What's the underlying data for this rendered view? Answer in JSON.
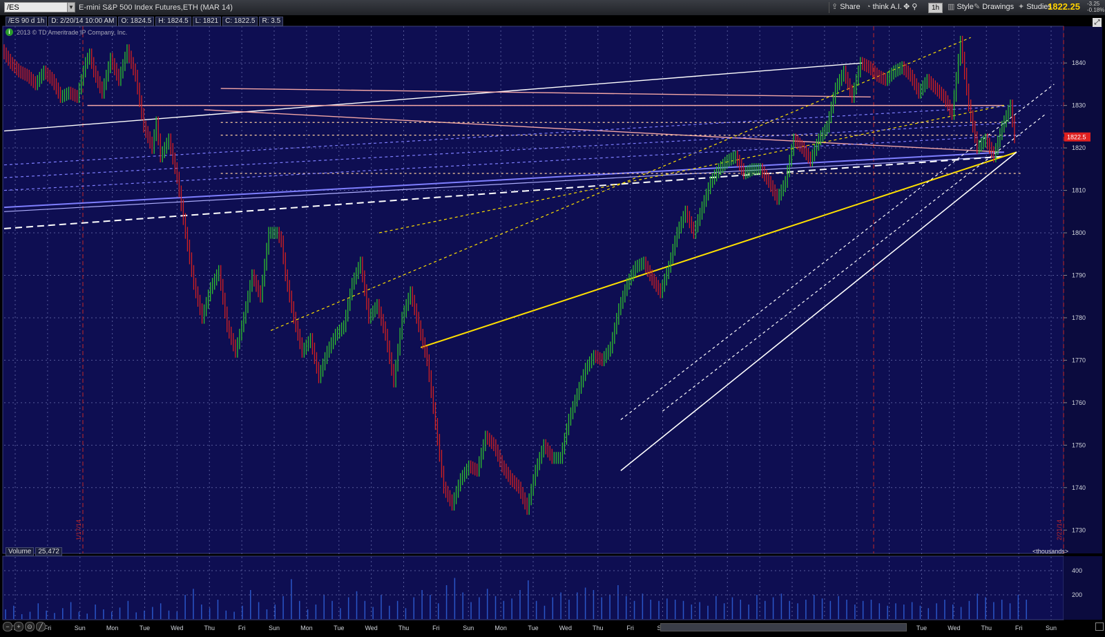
{
  "toolbar": {
    "symbol": "/ES",
    "instrument": "E-mini S&P 500 Index Futures,ETH (MAR 14)",
    "buttons": [
      "Share",
      "think A.I.",
      "1h",
      "Style",
      "Drawings",
      "Studies"
    ],
    "last_price": "1822.25",
    "change_abs": "-3.25",
    "change_pct": "-0.18%"
  },
  "info": {
    "period": "/ES 90 d 1h",
    "date": "D: 2/20/14 10:00 AM",
    "open": "O: 1824.5",
    "high": "H: 1824.5",
    "low": "L: 1821",
    "close": "C: 1822.5",
    "range": "R: 3.5",
    "copyright": "2013 © TD Ameritrade IP Company, Inc."
  },
  "volume_panel": {
    "label": "Volume",
    "value": "25,472",
    "unit": "<thousands>",
    "ticks": [
      "400",
      "200"
    ]
  },
  "colors": {
    "background": "#0e0e52",
    "up": "#2fbf2f",
    "down": "#d42020",
    "price_tag": "#e02020",
    "volume": "#2a56c8"
  },
  "chart_data": {
    "type": "line",
    "title": "",
    "price_axis": {
      "ylim": [
        1725,
        1848
      ],
      "ticks": [
        1730,
        1740,
        1750,
        1760,
        1770,
        1780,
        1790,
        1800,
        1810,
        1820,
        1830,
        1840
      ],
      "current_price": "1822.5"
    },
    "x_tick_labels": [
      "Thu",
      "Fri",
      "Sun",
      "Mon",
      "Tue",
      "Wed",
      "Thu",
      "Fri",
      "Sun",
      "Mon",
      "Tue",
      "Wed",
      "Thu",
      "Fri",
      "Sun",
      "Mon",
      "Tue",
      "Wed",
      "Thu",
      "Fri",
      "Sun",
      "Mon",
      "Tue",
      "Wed",
      "Thu",
      "Fri",
      "Sun",
      "Mon",
      "Tue",
      "Wed",
      "Thu",
      "Fri",
      "Sun"
    ],
    "date_markers": [
      "1/17/14",
      "2/21/14"
    ],
    "grid": true,
    "series": [
      {
        "name": "/ES",
        "x": [
          0,
          2,
          4,
          6,
          8,
          10,
          12,
          14,
          16,
          18,
          20,
          21,
          22,
          24,
          26,
          28,
          30,
          32,
          34,
          36,
          37,
          38,
          40,
          42,
          44,
          46,
          48,
          50,
          52,
          54,
          56,
          58,
          60,
          62,
          64,
          66,
          67,
          68,
          70,
          72,
          74,
          76,
          78,
          80,
          82,
          84,
          86,
          88,
          90,
          92,
          94,
          96,
          98,
          100,
          102,
          104,
          106,
          108,
          110,
          112,
          114,
          116,
          118,
          120,
          122,
          124,
          126,
          128,
          130,
          132,
          134,
          136,
          138,
          140,
          142,
          144,
          146,
          148,
          150,
          152,
          154,
          156,
          158,
          160,
          162,
          164,
          166,
          168,
          170,
          172,
          174,
          176,
          178,
          180,
          182,
          184,
          186,
          188,
          190,
          192,
          194,
          196,
          198,
          200,
          202,
          204,
          206,
          208,
          210,
          212,
          214,
          216,
          218,
          220,
          222,
          224,
          226,
          228,
          230,
          232,
          234,
          236,
          238,
          240,
          242,
          243
        ],
        "y": [
          1843,
          1840,
          1838,
          1837,
          1835,
          1838,
          1836,
          1832,
          1833,
          1832,
          1840,
          1842,
          1838,
          1833,
          1841,
          1836,
          1843,
          1837,
          1825,
          1820,
          1826,
          1818,
          1822,
          1813,
          1800,
          1788,
          1780,
          1787,
          1791,
          1778,
          1772,
          1780,
          1790,
          1785,
          1800,
          1800,
          1798,
          1790,
          1780,
          1772,
          1775,
          1766,
          1772,
          1776,
          1778,
          1788,
          1793,
          1780,
          1783,
          1776,
          1765,
          1780,
          1786,
          1778,
          1770,
          1755,
          1740,
          1736,
          1742,
          1745,
          1744,
          1752,
          1750,
          1745,
          1742,
          1740,
          1735,
          1744,
          1750,
          1747,
          1747,
          1756,
          1762,
          1768,
          1771,
          1770,
          1773,
          1782,
          1788,
          1792,
          1793,
          1789,
          1786,
          1792,
          1800,
          1805,
          1800,
          1806,
          1812,
          1815,
          1817,
          1818,
          1814,
          1815,
          1815,
          1812,
          1808,
          1812,
          1822,
          1820,
          1817,
          1822,
          1825,
          1834,
          1838,
          1832,
          1840,
          1839,
          1837,
          1836,
          1838,
          1839,
          1837,
          1833,
          1836,
          1834,
          1832,
          1828,
          1845,
          1830,
          1820,
          1822,
          1818,
          1825,
          1830,
          1822.5
        ]
      }
    ],
    "volume": {
      "ylim": [
        0,
        480
      ],
      "values": [
        80,
        110,
        40,
        60,
        130,
        70,
        50,
        90,
        140,
        60,
        45,
        120,
        80,
        60,
        95,
        150,
        55,
        70,
        100,
        130,
        70,
        60,
        200,
        250,
        120,
        90,
        160,
        70,
        60,
        110,
        240,
        140,
        80,
        120,
        190,
        330,
        150,
        80,
        120,
        200,
        150,
        90,
        180,
        230,
        150,
        100,
        200,
        110,
        150,
        90,
        180,
        240,
        200,
        130,
        280,
        340,
        220,
        140,
        180,
        250,
        190,
        150,
        170,
        240,
        320,
        150,
        110,
        180,
        220,
        160,
        220,
        260,
        240,
        180,
        200,
        280,
        190,
        150,
        210,
        160,
        150,
        170,
        160,
        150,
        120,
        140,
        110,
        190,
        130,
        180,
        160,
        120,
        200,
        150,
        180,
        210,
        150,
        130,
        160,
        200,
        170,
        150,
        190,
        160,
        120,
        150,
        160,
        130,
        110,
        130,
        120,
        140,
        110,
        90,
        130,
        160,
        120,
        100,
        150,
        210,
        180,
        140,
        160,
        130,
        200,
        160
      ]
    }
  }
}
